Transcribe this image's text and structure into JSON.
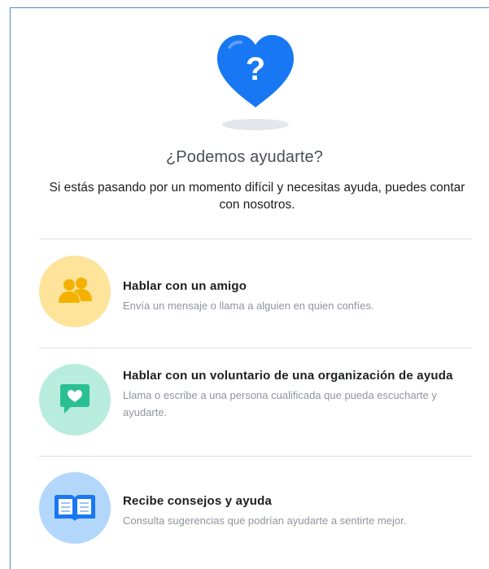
{
  "header": {
    "title": "¿Podemos ayudarte?",
    "subtitle": "Si estás pasando por un momento difícil y necesitas ayuda, puedes contar con nosotros.",
    "icon": "heart-question-icon"
  },
  "colors": {
    "heart": "#1877f2",
    "friend_circle": "#fde49a",
    "friend_icon": "#f5b100",
    "volunteer_circle": "#b8ecdc",
    "volunteer_icon": "#2bbf94",
    "tips_circle": "#b3d7fb",
    "tips_icon": "#1877f2"
  },
  "options": [
    {
      "icon": "two-people-icon",
      "title": "Hablar con un amigo",
      "description": "Envía un mensaje o llama a alguien en quien confíes."
    },
    {
      "icon": "chat-heart-icon",
      "title": "Hablar con un voluntario de una organización de ayuda",
      "description": "Llama o escribe a una persona cualificada que pueda escucharte y ayudarte."
    },
    {
      "icon": "open-book-icon",
      "title": "Recibe consejos y ayuda",
      "description": "Consulta sugerencias que podrían ayudarte a sentirte mejor."
    }
  ]
}
